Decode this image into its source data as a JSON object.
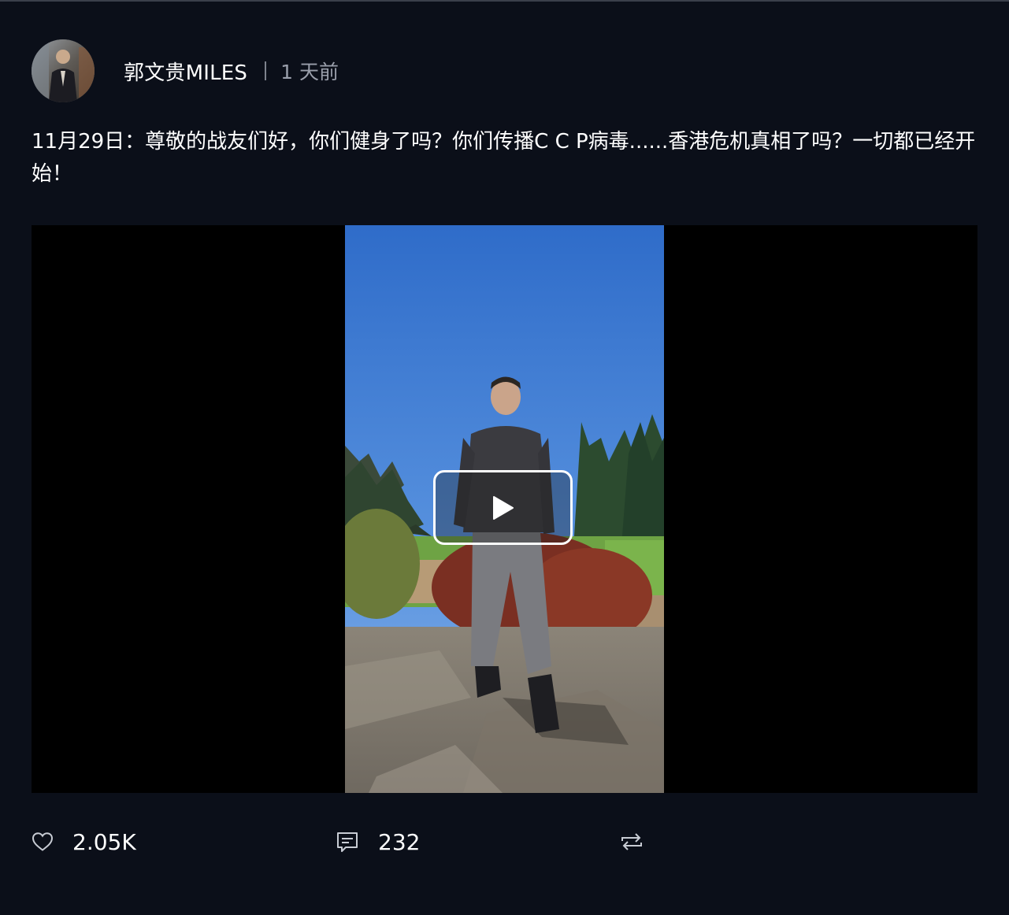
{
  "post": {
    "author": "郭文贵MILES",
    "time": "1 天前",
    "text": "11月29日：尊敬的战友们好，你们健身了吗？你们传播C C P病毒......香港危机真相了吗？一切都已经开始！"
  },
  "actions": {
    "likes": "2.05K",
    "comments": "232"
  },
  "icons": {
    "like": "heart-icon",
    "comment": "comment-icon",
    "share": "repost-icon",
    "play": "play-icon"
  },
  "colors": {
    "background": "#0b0f19",
    "secondary_text": "#9a9fab",
    "icon": "#c8ccd4"
  }
}
